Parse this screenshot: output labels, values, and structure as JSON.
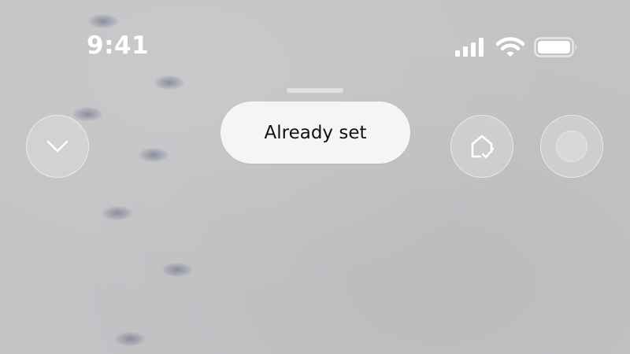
{
  "status_bar": {
    "time": "9:41",
    "icons": [
      "cellular-signal-icon",
      "wifi-icon",
      "battery-icon"
    ]
  },
  "toast": {
    "message": "Already set"
  },
  "controls": {
    "left_button_icon": "chevron-down-icon",
    "home_button_icon": "home-check-icon",
    "record_button_icon": "record-circle-icon"
  },
  "colors": {
    "background": "#c3c3c6",
    "paw_prints": "#5a5f78",
    "toast_background": "#f5f5f4",
    "toast_text": "#111111",
    "status_text": "#ffffff"
  }
}
